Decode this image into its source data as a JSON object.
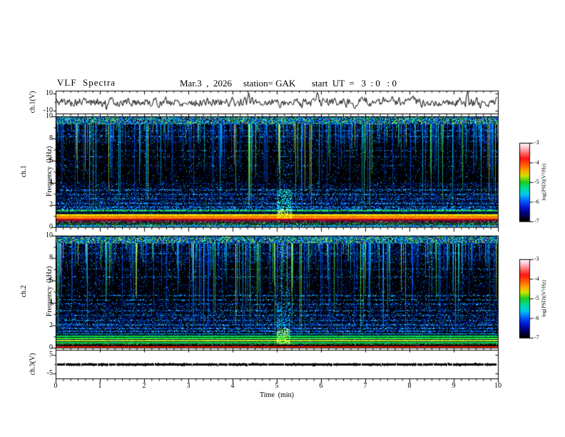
{
  "header": {
    "title": "VLF  Spectra",
    "date": "Mar.3  ,  2026",
    "station": "station= GAK",
    "start_ut": "start  UT  =   3  : 0   : 0"
  },
  "xaxis": {
    "label": "Time  (min)",
    "ticks": [
      "0",
      "1",
      "2",
      "3",
      "4",
      "5",
      "6",
      "7",
      "8",
      "9",
      "10"
    ]
  },
  "panels": {
    "wave1": {
      "ylabel": "ch.1(V)",
      "yticks": [
        "10",
        "-10"
      ]
    },
    "spec1": {
      "ylabel1": "ch.1",
      "ylabel2": "Frequency  (kHz)",
      "yticks": [
        "10",
        "8",
        "6",
        "4",
        "2",
        "0"
      ]
    },
    "spec2": {
      "ylabel1": "ch.2",
      "ylabel2": "Frequency  (kHz)",
      "yticks": [
        "10",
        "8",
        "6",
        "4",
        "2",
        "0"
      ]
    },
    "wave3": {
      "ylabel": "ch.3(V)",
      "yticks": [
        "5",
        "-5"
      ]
    }
  },
  "colorbars": [
    {
      "label": "log(PSD)(V²/Hz)",
      "ticks": [
        "-3",
        "-4",
        "-5",
        "-6",
        "-7"
      ]
    },
    {
      "label": "log(PSD)(V²/Hz)",
      "ticks": [
        "-3",
        "-4",
        "-5",
        "-6",
        "-7"
      ]
    }
  ],
  "colormap": {
    "zlim": [
      -7,
      -3
    ],
    "gradient": [
      [
        0,
        "#ffffff"
      ],
      [
        0.06,
        "#ffc4d4"
      ],
      [
        0.12,
        "#ff7878"
      ],
      [
        0.2,
        "#ff1414"
      ],
      [
        0.28,
        "#ff5a00"
      ],
      [
        0.36,
        "#ffaa00"
      ],
      [
        0.42,
        "#cfe400"
      ],
      [
        0.5,
        "#1ecc1e"
      ],
      [
        0.58,
        "#00dd99"
      ],
      [
        0.66,
        "#00c8f0"
      ],
      [
        0.74,
        "#0060ff"
      ],
      [
        0.82,
        "#0018d8"
      ],
      [
        0.9,
        "#000078"
      ],
      [
        0.97,
        "#000018"
      ],
      [
        1,
        "#000000"
      ]
    ]
  },
  "chart_data": [
    {
      "type": "line",
      "panel": "ch.1(V)",
      "xlim": [
        0,
        10
      ],
      "ylim": [
        -10,
        10
      ],
      "xlabel": "Time (min)",
      "ylabel": "ch.1(V)",
      "series_description": "broadband noisy voltage ~ ±2 V about 0 V for the full 10 minutes",
      "seed": 5,
      "noise_amplitude_v": 1.5,
      "spikes": [
        {
          "t_min": 1.15,
          "v": -4
        },
        {
          "t_min": 4.35,
          "v": 3.5
        },
        {
          "t_min": 5.9,
          "v": 4
        },
        {
          "t_min": 7.6,
          "v": 3.2
        },
        {
          "t_min": 9.3,
          "v": 6.5
        },
        {
          "t_min": 9.6,
          "v": -3.5
        }
      ]
    },
    {
      "type": "heatmap",
      "panel": "ch.1 spectrogram",
      "xlabel": "Time (min)",
      "ylabel": "Frequency (kHz)",
      "xlim": [
        0,
        10
      ],
      "ylim": [
        0,
        10
      ],
      "zlabel": "log(PSD)(V²/Hz)",
      "zlim": [
        -7,
        -3
      ],
      "features": [
        "dense multicolor activity band 9.3-10 kHz",
        "vertical sferic streaks from top, mostly blue/cyan, some green/yellow",
        "diffuse blue noise 1.5-4 kHz with horizontal line structure",
        "strong harmonic bands below 1.5 kHz: green line ~1.45 kHz, yellow ~1.1, orange 0.8-1.0, red ~0.75, purple speckle 0.4-0.6, blue/green speckle near 0",
        "broadband disturbance near t=5.1 min"
      ],
      "render": {
        "seed": 7,
        "top_f": 9.3,
        "zones": [
          [
            7.6,
            9.3,
            0.3
          ],
          [
            4.0,
            7.6,
            0.1
          ],
          [
            3.0,
            4.0,
            0.28
          ],
          [
            1.52,
            3.0,
            0.42
          ],
          [
            0,
            1.52,
            0.12
          ]
        ],
        "rows": [
          [
            8.7,
            0.18
          ],
          [
            8.2,
            0.18
          ],
          [
            6.9,
            0.15
          ],
          [
            6.35,
            0.28
          ],
          [
            5.55,
            0.1
          ],
          [
            3.35,
            0.35
          ],
          [
            2.95,
            0.32
          ],
          [
            2.55,
            0.42
          ],
          [
            2.15,
            0.38
          ],
          [
            1.8,
            0.48
          ],
          [
            1.62,
            0.4
          ]
        ],
        "streaks": {
          "prob": 0.55,
          "exp": 2.4,
          "max_frac": 0.92
        },
        "bands": [
          [
            1.52,
            1.4,
            "#22ee55",
            "line"
          ],
          [
            1.4,
            1.16,
            "#04102e",
            "gap"
          ],
          [
            1.16,
            1.02,
            "#ffee00",
            "solid"
          ],
          [
            1.02,
            0.8,
            "#ff8800",
            "solid"
          ],
          [
            0.8,
            0.7,
            "#ff3300",
            "solid"
          ],
          [
            0.7,
            0.58,
            "#99002a",
            "solid"
          ],
          [
            0.58,
            0.36,
            "#7a1f5e",
            "speckle"
          ],
          [
            0.36,
            0.2,
            "#0a2a0a",
            "speckle2"
          ],
          [
            0.2,
            0.0,
            "#1060c0",
            "speckle3"
          ]
        ],
        "event": {
          "t0": 5.0,
          "t1": 5.35,
          "blobs": [
            [
              3.4,
              9.3,
              0.1,
              [
                "#0080ff"
              ]
            ],
            [
              1.4,
              3.4,
              0.4,
              [
                "#00e0ff",
                "#40ff80"
              ]
            ],
            [
              0.8,
              1.6,
              0.55,
              [
                "#ffee00",
                "#80ff40"
              ]
            ]
          ]
        }
      }
    },
    {
      "type": "heatmap",
      "panel": "ch.2 spectrogram",
      "xlabel": "Time (min)",
      "ylabel": "Frequency (kHz)",
      "xlim": [
        0,
        10
      ],
      "ylim": [
        0,
        10
      ],
      "zlabel": "log(PSD)(V²/Hz)",
      "zlim": [
        -7,
        -3
      ],
      "features": [
        "dense multicolor activity band 9.3-10 kHz",
        "vertical sferic streaks from top",
        "diffuse blue noise 1.3-4 kHz with horizontal rows",
        "green/yellow harmonic lines below 1.3 kHz and thin red line near 0 kHz",
        "disturbance near t=5.1 min with green/yellow blob below 1.7 kHz and blue blob 8-10 kHz"
      ],
      "render": {
        "seed": 23,
        "top_f": 9.3,
        "zones": [
          [
            7.6,
            9.3,
            0.3
          ],
          [
            4.0,
            7.6,
            0.12
          ],
          [
            3.0,
            4.0,
            0.26
          ],
          [
            1.35,
            3.0,
            0.4
          ],
          [
            0,
            1.35,
            0.12
          ]
        ],
        "rows": [
          [
            8.4,
            0.2
          ],
          [
            7.0,
            0.12
          ],
          [
            6.3,
            0.18
          ],
          [
            4.65,
            0.32
          ],
          [
            4.25,
            0.28
          ],
          [
            3.9,
            0.22
          ],
          [
            3.3,
            0.28
          ],
          [
            2.9,
            0.38
          ],
          [
            2.45,
            0.42
          ],
          [
            2.05,
            0.46
          ],
          [
            1.7,
            0.42
          ],
          [
            1.45,
            0.45
          ]
        ],
        "streaks": {
          "prob": 0.55,
          "exp": 2.4,
          "max_frac": 0.92
        },
        "bands": [
          [
            1.3,
            1.2,
            "#00bbee",
            "line"
          ],
          [
            1.2,
            1.08,
            "#03102a",
            "gap"
          ],
          [
            1.08,
            0.98,
            "#00dd44",
            "solid"
          ],
          [
            0.98,
            0.88,
            "#03102a",
            "gap"
          ],
          [
            0.88,
            0.78,
            "#33ee33",
            "solid"
          ],
          [
            0.78,
            0.68,
            "#03102a",
            "gap"
          ],
          [
            0.68,
            0.58,
            "#bbee22",
            "solid"
          ],
          [
            0.58,
            0.48,
            "#02200a",
            "gap"
          ],
          [
            0.48,
            0.38,
            "#00cc55",
            "solid"
          ],
          [
            0.38,
            0.24,
            "#3d5c10",
            "speckle"
          ],
          [
            0.24,
            0.12,
            "#050505",
            "gap"
          ],
          [
            0.12,
            0.02,
            "#ee2200",
            "solid"
          ]
        ],
        "event": {
          "t0": 5.0,
          "t1": 5.3,
          "blobs": [
            [
              8.0,
              9.3,
              0.35,
              [
                "#2060ff",
                "#4090ff"
              ]
            ],
            [
              4.0,
              8.0,
              0.12,
              [
                "#2080ff",
                "#00d0ff"
              ]
            ],
            [
              1.7,
              4.0,
              0.28,
              [
                "#00cfff"
              ]
            ],
            [
              0.3,
              1.7,
              0.6,
              [
                "#aaff33",
                "#33ee66",
                "#ffee44"
              ]
            ]
          ]
        }
      }
    },
    {
      "type": "line",
      "panel": "ch.3(V)",
      "xlim": [
        0,
        10
      ],
      "ylim": [
        -5,
        5
      ],
      "xlabel": "Time (min)",
      "ylabel": "ch.3(V)",
      "series_description": "flat speckled line at ~0 V for full 10 minutes",
      "seed": 11,
      "value_v": 0
    }
  ]
}
